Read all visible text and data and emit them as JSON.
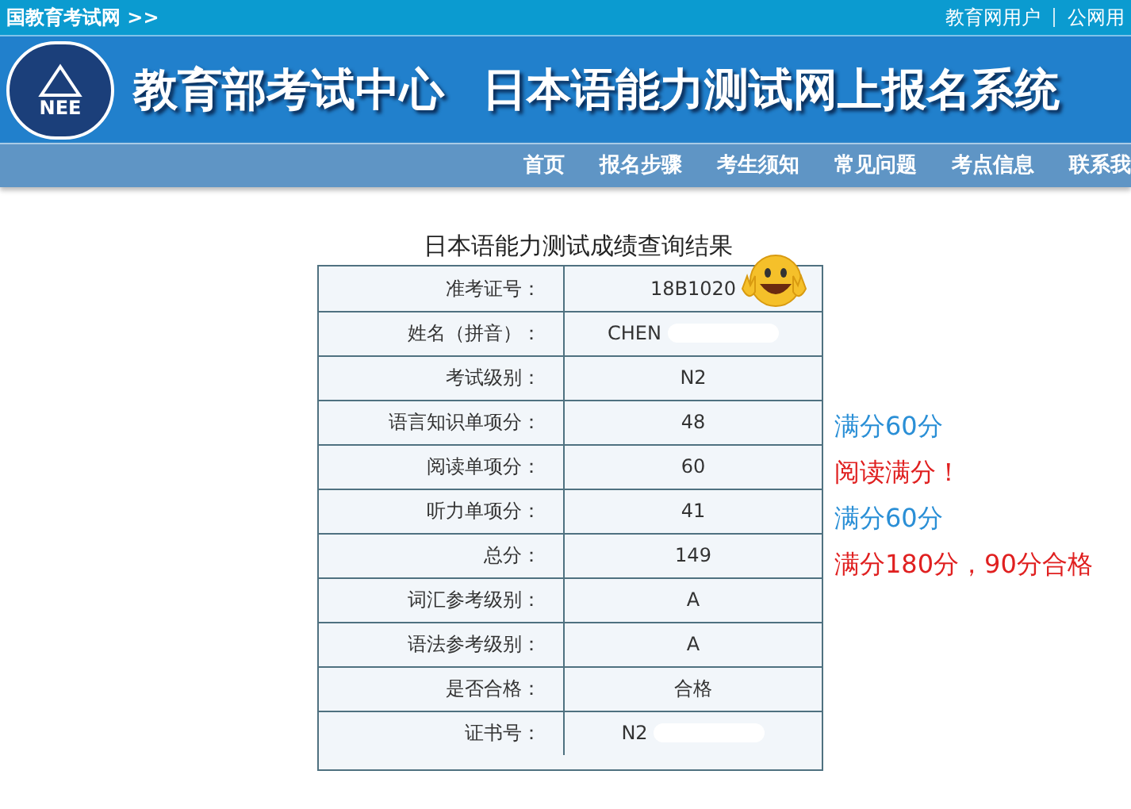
{
  "top_bar": {
    "left_link": "国教育考试网 >>",
    "right_links": [
      "教育网用户",
      "公网用"
    ]
  },
  "header": {
    "logo_text": "NEE",
    "org": "教育部考试中心",
    "system": "日本语能力测试网上报名系统"
  },
  "nav": [
    "首页",
    "报名步骤",
    "考生须知",
    "常见问题",
    "考点信息",
    "联系我"
  ],
  "result": {
    "title": "日本语能力测试成绩查询结果",
    "rows": [
      {
        "label": "准考证号：",
        "value": "18B1020",
        "sticker": true
      },
      {
        "label": "姓名（拼音）：",
        "value": "CHEN",
        "redacted": true
      },
      {
        "label": "考试级别：",
        "value": "N2"
      },
      {
        "label": "语言知识单项分：",
        "value": "48",
        "note": "满分60分",
        "color": "#2a8fd6"
      },
      {
        "label": "阅读单项分：",
        "value": "60",
        "note": "阅读满分！",
        "color": "#e02020"
      },
      {
        "label": "听力单项分：",
        "value": "41",
        "note": "满分60分",
        "color": "#2a8fd6"
      },
      {
        "label": "总分：",
        "value": "149",
        "note": "满分180分，90分合格",
        "color": "#e02020"
      },
      {
        "label": "词汇参考级别：",
        "value": "A"
      },
      {
        "label": "语法参考级别：",
        "value": "A"
      },
      {
        "label": "是否合格：",
        "value": "合格"
      },
      {
        "label": "证书号：",
        "value": "N2",
        "redacted": true
      }
    ]
  }
}
